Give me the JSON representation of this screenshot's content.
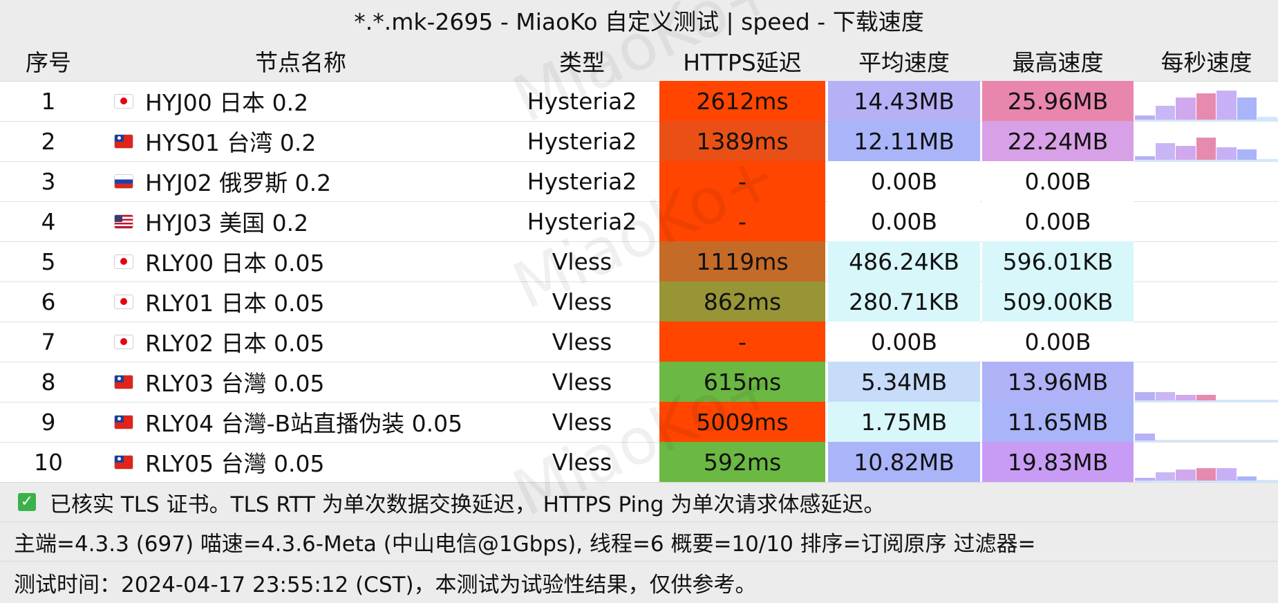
{
  "title": "*.*.mk-2695 - MiaoKo 自定义测试 | speed - 下载速度",
  "watermark": "MiaoKo+",
  "columns": {
    "index": "序号",
    "name": "节点名称",
    "type": "类型",
    "latency": "HTTPS延迟",
    "avg": "平均速度",
    "max": "最高速度",
    "per_sec": "每秒速度"
  },
  "rows": [
    {
      "index": "1",
      "flag": "flag-jp",
      "name": "HYJ00 日本 0.2",
      "type": "Hysteria2",
      "latency": "2612ms",
      "avg": "14.43MB",
      "max": "25.96MB",
      "lat_color": "#ff4500",
      "avg_color": "#b6b0f6",
      "max_color": "#e986ad",
      "spark": [
        0.12,
        0.4,
        0.64,
        0.76,
        0.84,
        0.64,
        0.08
      ]
    },
    {
      "index": "2",
      "flag": "flag-tw",
      "name": "HYS01 台湾 0.2",
      "type": "Hysteria2",
      "latency": "1389ms",
      "avg": "12.11MB",
      "max": "22.24MB",
      "lat_color": "#ea5016",
      "avg_color": "#aab4f8",
      "max_color": "#d8a0e6",
      "spark": [
        0.1,
        0.48,
        0.4,
        0.64,
        0.36,
        0.3,
        0.0
      ]
    },
    {
      "index": "3",
      "flag": "flag-ru",
      "name": "HYJ02 俄罗斯 0.2",
      "type": "Hysteria2",
      "latency": "-",
      "avg": "0.00B",
      "max": "0.00B",
      "lat_color": "#ff4500",
      "avg_color": "#ffffff",
      "max_color": "#ffffff",
      "spark": []
    },
    {
      "index": "4",
      "flag": "flag-us",
      "name": "HYJ03 美国 0.2",
      "type": "Hysteria2",
      "latency": "-",
      "avg": "0.00B",
      "max": "0.00B",
      "lat_color": "#ff4500",
      "avg_color": "#ffffff",
      "max_color": "#ffffff",
      "spark": []
    },
    {
      "index": "5",
      "flag": "flag-jp",
      "name": "RLY00 日本 0.05",
      "type": "Vless",
      "latency": "1119ms",
      "avg": "486.24KB",
      "max": "596.01KB",
      "lat_color": "#c56b28",
      "avg_color": "#d8f7fa",
      "max_color": "#d8f7fa",
      "spark": []
    },
    {
      "index": "6",
      "flag": "flag-jp",
      "name": "RLY01 日本 0.05",
      "type": "Vless",
      "latency": "862ms",
      "avg": "280.71KB",
      "max": "509.00KB",
      "lat_color": "#979536",
      "avg_color": "#d8f7fa",
      "max_color": "#d8f7fa",
      "spark": []
    },
    {
      "index": "7",
      "flag": "flag-jp",
      "name": "RLY02 日本 0.05",
      "type": "Vless",
      "latency": "-",
      "avg": "0.00B",
      "max": "0.00B",
      "lat_color": "#ff4500",
      "avg_color": "#ffffff",
      "max_color": "#ffffff",
      "spark": []
    },
    {
      "index": "8",
      "flag": "flag-tw",
      "name": "RLY03 台灣 0.05",
      "type": "Vless",
      "latency": "615ms",
      "avg": "5.34MB",
      "max": "13.96MB",
      "lat_color": "#6bb842",
      "avg_color": "#c6dcf9",
      "max_color": "#b0b2f7",
      "spark": [
        0.24,
        0.24,
        0.16,
        0.16,
        0.0,
        0.0,
        0.0
      ]
    },
    {
      "index": "9",
      "flag": "flag-tw",
      "name": "RLY04 台灣-B站直播伪装 0.05",
      "type": "Vless",
      "latency": "5009ms",
      "avg": "1.75MB",
      "max": "11.65MB",
      "lat_color": "#ff4500",
      "avg_color": "#d8f7fa",
      "max_color": "#aab4f8",
      "spark": [
        0.2,
        0.0,
        0.0,
        0.0,
        0.0,
        0.0,
        0.0
      ]
    },
    {
      "index": "10",
      "flag": "flag-tw",
      "name": "RLY05 台灣 0.05",
      "type": "Vless",
      "latency": "592ms",
      "avg": "10.82MB",
      "max": "19.83MB",
      "lat_color": "#6bb842",
      "avg_color": "#aab4f8",
      "max_color": "#c89cf4",
      "spark": [
        0.08,
        0.24,
        0.32,
        0.36,
        0.36,
        0.12,
        0.0
      ]
    }
  ],
  "footer": {
    "tls_note": "已核实 TLS 证书。TLS RTT 为单次数据交换延迟， HTTPS Ping 为单次请求体感延迟。",
    "info": "主端=4.3.3 (697) 喵速=4.3.6-Meta (中山电信@1Gbps), 线程=6 概要=10/10 排序=订阅原序 过滤器=",
    "time": "测试时间：2024-04-17 23:55:12 (CST)，本测试为试验性结果，仅供参考。"
  }
}
